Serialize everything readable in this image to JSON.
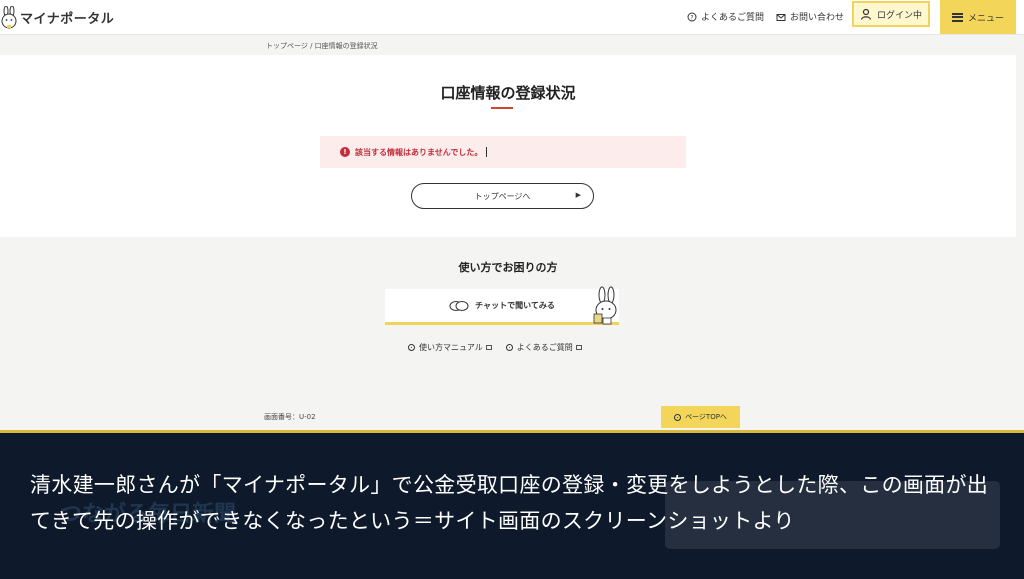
{
  "header": {
    "logo_text": "マイナポータル",
    "faq_label": "よくあるご質問",
    "contact_label": "お問い合わせ",
    "login_label": "ログイン中",
    "menu_label": "メニュー"
  },
  "breadcrumb": "トップページ / 口座情報の登録状況",
  "main": {
    "title": "口座情報の登録状況",
    "error_message": "該当する情報はありませんでした。",
    "top_button_label": "トップページへ",
    "accent_color": "#d2452f"
  },
  "help": {
    "title": "使い方でお困りの方",
    "chat_label": "チャットで聞いてみる",
    "manual_link": "使い方マニュアル",
    "faq_link": "よくあるご質問"
  },
  "footer": {
    "screen_number": "画面番号：U-02",
    "page_top_label": "ページTOPへ"
  },
  "caption": {
    "text": "清水建一郎さんが「マイナポータル」で公金受取口座の登録・変更をしようとした際、この画面が出てきて先の操作ができなくなったという＝サイト画面のスクリーンショットより",
    "ghost_text": "つながる毎日新聞"
  }
}
